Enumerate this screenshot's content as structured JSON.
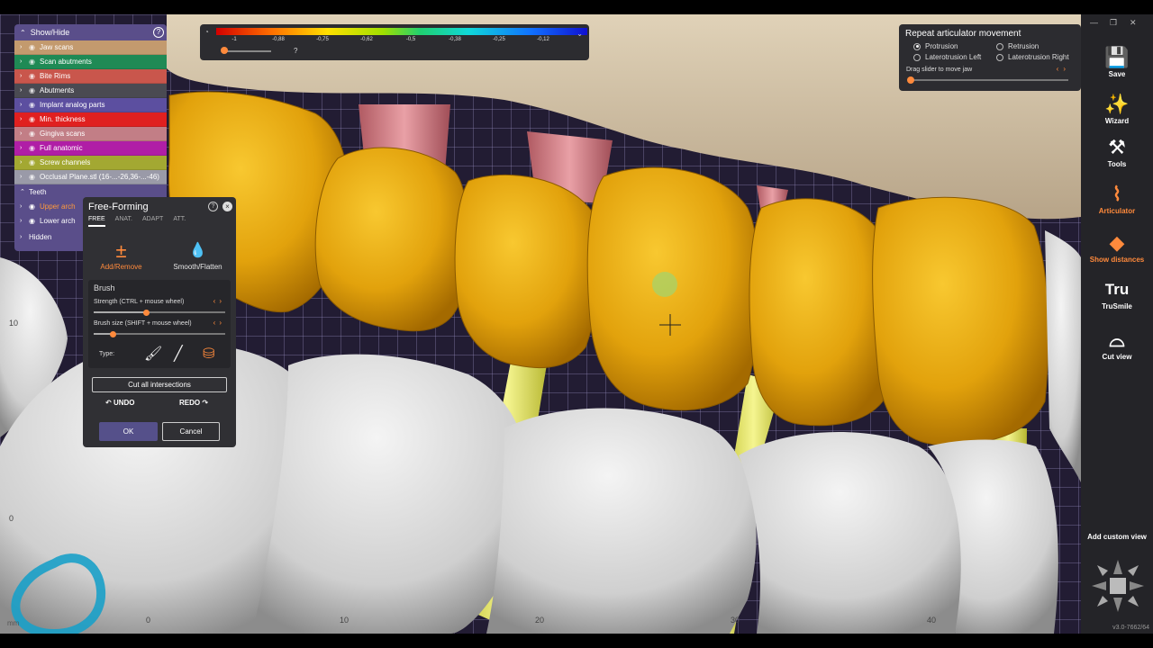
{
  "show_hide": {
    "title": "Show/Hide",
    "layers": [
      {
        "label": "Jaw scans",
        "color": "#c39a6e"
      },
      {
        "label": "Scan abutments",
        "color": "#1f8a55"
      },
      {
        "label": "Bite Rims",
        "color": "#c9564c"
      },
      {
        "label": "Abutments",
        "color": "#4a4a52"
      },
      {
        "label": "Implant analog parts",
        "color": "#5c4fa0"
      },
      {
        "label": "Min. thickness",
        "color": "#e02020"
      },
      {
        "label": "Gingiva scans",
        "color": "#c27e86"
      },
      {
        "label": "Full anatomic",
        "color": "#b01ea6"
      },
      {
        "label": "Screw channels",
        "color": "#a3a832"
      },
      {
        "label": "Occlusal Plane.stl (16-...-26,36-...-46)",
        "color": "#9a9aa8"
      }
    ],
    "teeth_label": "Teeth",
    "teeth": [
      "Upper arch",
      "Lower arch"
    ],
    "hidden_label": "Hidden"
  },
  "color_scale": {
    "ticks": [
      "-1",
      "-0,88",
      "-0,75",
      "-0,62",
      "-0,5",
      "-0,38",
      "-0,25",
      "-0,12"
    ],
    "help": "?",
    "slider_fraction": 0.05
  },
  "articulator": {
    "title": "Repeat articulator movement",
    "options": [
      {
        "label": "Protrusion",
        "selected": true
      },
      {
        "label": "Retrusion",
        "selected": false
      },
      {
        "label": "Laterotrusion Left",
        "selected": false
      },
      {
        "label": "Laterotrusion Right",
        "selected": false
      }
    ],
    "drag_label": "Drag slider to move jaw",
    "slider_fraction": 0.0
  },
  "free_forming": {
    "title": "Free-Forming",
    "tabs": [
      "FREE",
      "ANAT.",
      "ADAPT",
      "ATT."
    ],
    "active_tab": "FREE",
    "tools": [
      {
        "label": "Add/Remove",
        "icon": "plus-minus-icon",
        "glyph": "±",
        "active": true
      },
      {
        "label": "Smooth/Flatten",
        "icon": "droplet-icon",
        "glyph": "💧",
        "active": false
      }
    ],
    "brush_title": "Brush",
    "strength_label": "Strength (CTRL + mouse wheel)",
    "strength_fraction": 0.4,
    "size_label": "Brush size (SHIFT + mouse wheel)",
    "size_fraction": 0.15,
    "type_label": "Type:",
    "cut_label": "Cut all intersections",
    "undo_label": "UNDO",
    "redo_label": "REDO",
    "ok_label": "OK",
    "cancel_label": "Cancel"
  },
  "toolbar": {
    "items": [
      {
        "label": "Save",
        "icon": "save-icon",
        "glyph": "💾",
        "color": "#ffffff"
      },
      {
        "label": "Wizard",
        "icon": "wizard-icon",
        "glyph": "✨",
        "color": "#ffffff"
      },
      {
        "label": "Tools",
        "icon": "tools-icon",
        "glyph": "⚒",
        "color": "#ffffff"
      },
      {
        "label": "Articulator",
        "icon": "articulator-icon",
        "glyph": "⌇",
        "color": "#ff8a3c"
      },
      {
        "label": "Show distances",
        "icon": "distances-icon",
        "glyph": "◆",
        "color": "#ff8a3c"
      },
      {
        "label": "TruSmile",
        "icon": "trusmile-icon",
        "glyph": "Tru",
        "color": "#ffffff"
      },
      {
        "label": "Cut view",
        "icon": "cut-view-icon",
        "glyph": "⌓",
        "color": "#ffffff"
      }
    ],
    "custom_view_label": "Add custom view",
    "version": "v3.0-7662/64"
  },
  "rulers": {
    "bottom": [
      "0",
      "10",
      "20",
      "30",
      "40"
    ],
    "left": [
      "10",
      "0"
    ],
    "unit": "mm"
  },
  "accent_color": "#ff8a3c"
}
